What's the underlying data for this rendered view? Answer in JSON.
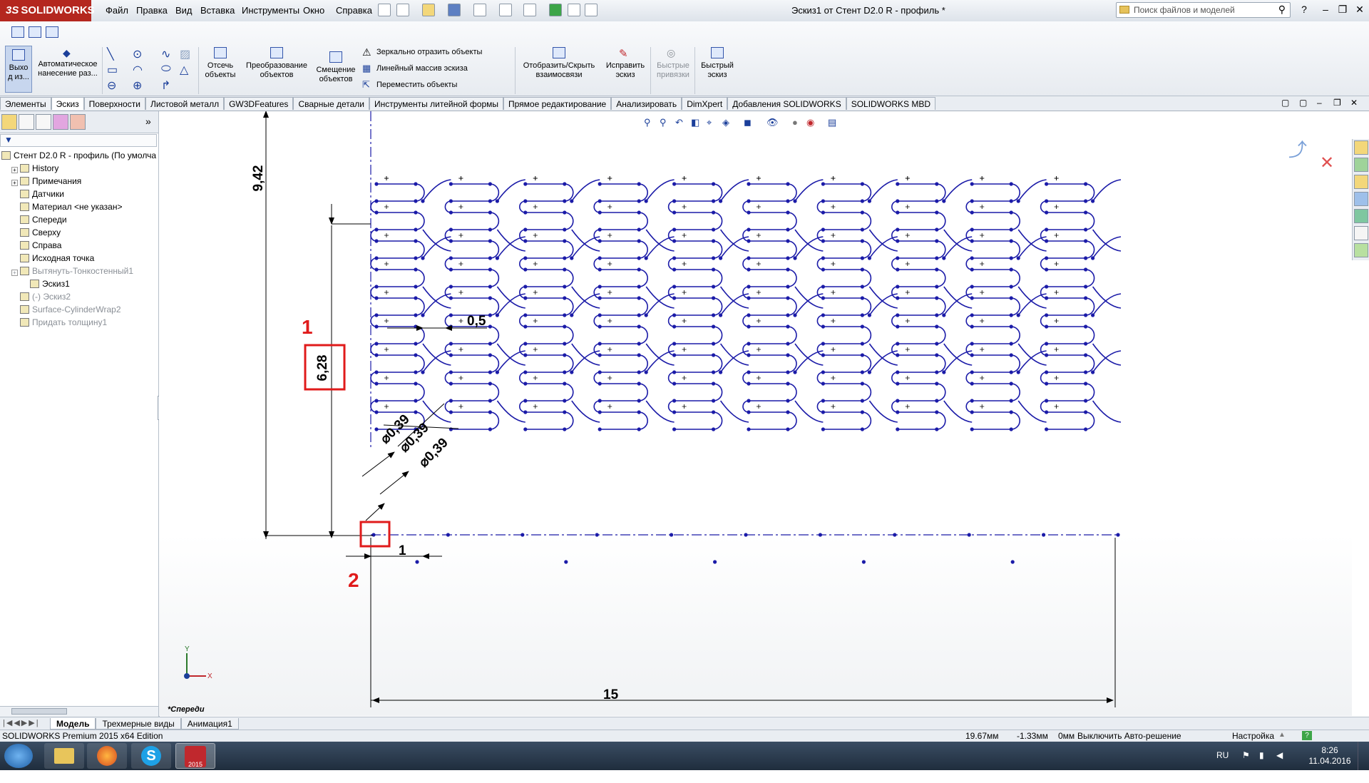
{
  "app": {
    "logo_text": "SOLIDWORKS",
    "logo_mark": "3S",
    "window_title": "Эскиз1 от Стент D2.0 R - профиль *"
  },
  "menu": [
    "Файл",
    "Правка",
    "Вид",
    "Вставка",
    "Инструменты",
    "Окно",
    "Справка"
  ],
  "search": {
    "placeholder": "Поиск файлов и моделей"
  },
  "ribbon": {
    "exit_sketch": "Выхо\nд из...",
    "auto_dim": "Автоматическое\nнанесение раз...",
    "trim": "Отсечь\nобъекты",
    "convert": "Преобразование\nобъектов",
    "offset": "Смещение\nобъектов",
    "mirror": "Зеркально отразить объекты",
    "linear_pattern": "Линейный массив эскиза",
    "move": "Переместить объекты",
    "relations": "Отобразить/Скрыть\nвзаимосвязи",
    "repair": "Исправить\nэскиз",
    "quick_snaps": "Быстрые\nпривязки",
    "rapid_sketch": "Быстрый\nэскиз"
  },
  "tabs": [
    "Элементы",
    "Эскиз",
    "Поверхности",
    "Листовой металл",
    "GW3DFeatures",
    "Сварные детали",
    "Инструменты литейной формы",
    "Прямое редактирование",
    "Анализировать",
    "DimXpert",
    "Добавления SOLIDWORKS",
    "SOLIDWORKS MBD"
  ],
  "active_tab": "Эскиз",
  "tree": [
    {
      "label": "Стент D2.0 R - профиль  (По умолча",
      "level": 0,
      "gray": false,
      "expand": false
    },
    {
      "label": "History",
      "level": 1,
      "gray": false,
      "expand": true
    },
    {
      "label": "Примечания",
      "level": 1,
      "gray": false,
      "expand": true
    },
    {
      "label": "Датчики",
      "level": 1,
      "gray": false,
      "expand": false
    },
    {
      "label": "Материал <не указан>",
      "level": 1,
      "gray": false,
      "expand": false
    },
    {
      "label": "Спереди",
      "level": 1,
      "gray": false,
      "expand": false
    },
    {
      "label": "Сверху",
      "level": 1,
      "gray": false,
      "expand": false
    },
    {
      "label": "Справа",
      "level": 1,
      "gray": false,
      "expand": false
    },
    {
      "label": "Исходная точка",
      "level": 1,
      "gray": false,
      "expand": false
    },
    {
      "label": "Вытянуть-Тонкостенный1",
      "level": 1,
      "gray": true,
      "expand": true
    },
    {
      "label": "Эскиз1",
      "level": 2,
      "gray": false,
      "expand": false
    },
    {
      "label": "(-) Эскиз2",
      "level": 1,
      "gray": true,
      "expand": false
    },
    {
      "label": "Surface-CylinderWrap2",
      "level": 1,
      "gray": true,
      "expand": false
    },
    {
      "label": "Придать толщину1",
      "level": 1,
      "gray": true,
      "expand": false
    }
  ],
  "drawing": {
    "view_label": "*Спереди",
    "dim_height_total": "9,42",
    "dim_height_cell": "6,28",
    "dim_gap": "0,5",
    "dim_dia1": "⌀0,39",
    "dim_dia2": "⌀0,39",
    "dim_dia3": "⌀0,39",
    "dim_one": "1",
    "dim_width": "15",
    "marker1": "1",
    "marker2": "2",
    "axis_x": "X",
    "axis_y": "Y",
    "line_color": "#1b1ba8",
    "dim_color": "#000000",
    "highlight_color": "#e01b1b"
  },
  "bottom_tabs": [
    "Модель",
    "Трехмерные виды",
    "Анимация1"
  ],
  "active_bottom_tab": "Модель",
  "status": {
    "edition": "SOLIDWORKS Premium 2015 x64 Edition",
    "x": "19.67мм",
    "y": "-1.33мм",
    "z": "0мм",
    "solver": "Выключить Авто-решение",
    "settings": "Настройка"
  },
  "taskbar": {
    "lang": "RU",
    "time": "8:26",
    "date": "11.04.2016",
    "sw_badge": "2015"
  }
}
